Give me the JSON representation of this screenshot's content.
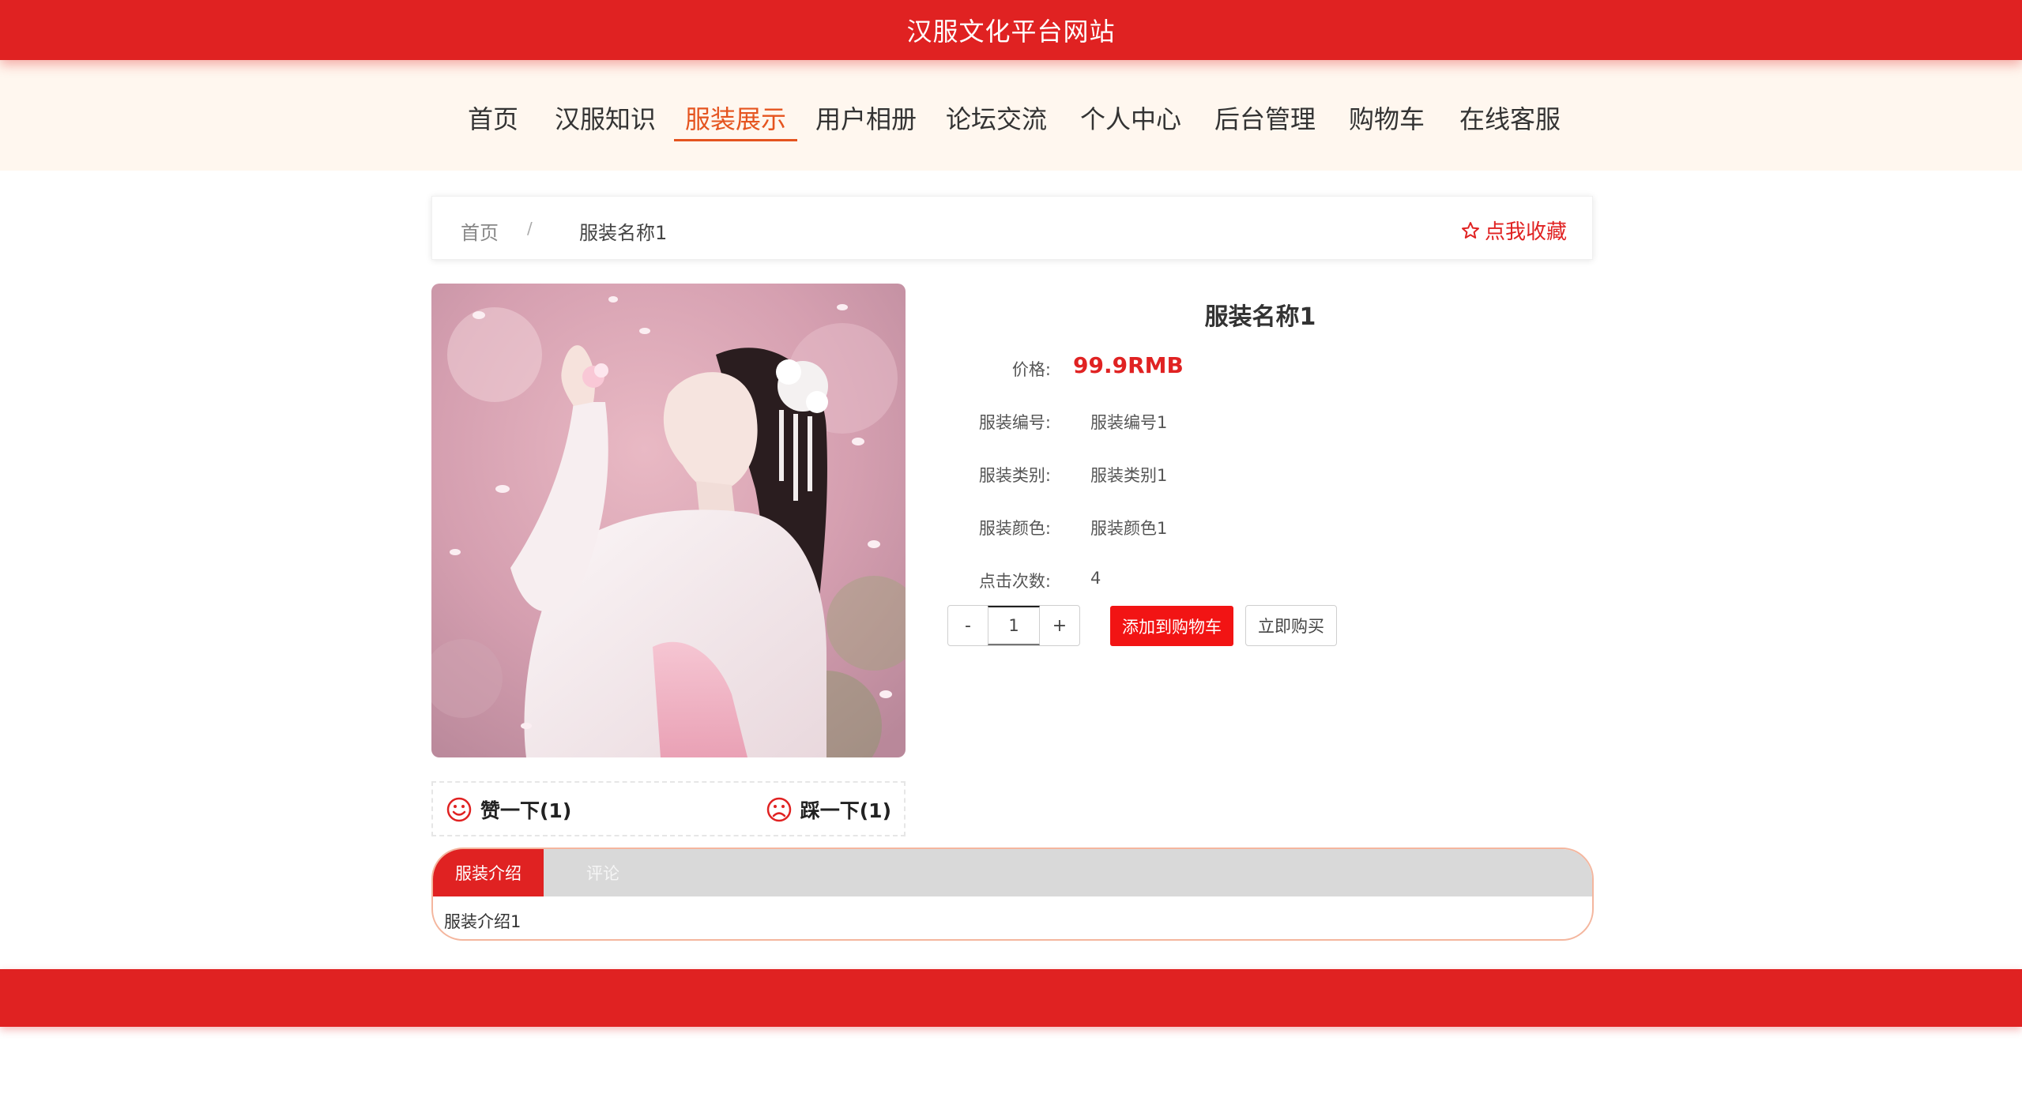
{
  "site_title": "汉服文化平台网站",
  "nav": {
    "items": [
      {
        "label": "首页"
      },
      {
        "label": "汉服知识"
      },
      {
        "label": "服装展示",
        "active": true
      },
      {
        "label": "用户相册"
      },
      {
        "label": "论坛交流"
      },
      {
        "label": "个人中心"
      },
      {
        "label": "后台管理"
      },
      {
        "label": "购物车"
      },
      {
        "label": "在线客服"
      }
    ]
  },
  "breadcrumb": {
    "home": "首页",
    "separator": "/",
    "current": "服装名称1",
    "favorite_label": "点我收藏",
    "favorite_icon": "star-outline-icon"
  },
  "product": {
    "name": "服装名称1",
    "price_label": "价格:",
    "price": "99.9RMB",
    "fields": [
      {
        "label": "服装编号:",
        "value": "服装编号1"
      },
      {
        "label": "服装类别:",
        "value": "服装类别1"
      },
      {
        "label": "服装颜色:",
        "value": "服装颜色1"
      },
      {
        "label": "点击次数:",
        "value": "4"
      }
    ],
    "image_desc": "hanfu-photo"
  },
  "quantity": {
    "minus": "-",
    "value": "1",
    "plus": "+"
  },
  "actions": {
    "add_to_cart": "添加到购物车",
    "buy_now": "立即购买"
  },
  "votes": {
    "up_label": "赞一下(1)",
    "up_icon": "smile-icon",
    "down_label": "踩一下(1)",
    "down_icon": "frown-icon"
  },
  "tabs": {
    "items": [
      {
        "label": "服装介绍",
        "active": true
      },
      {
        "label": "评论"
      }
    ],
    "content": "服装介绍1"
  },
  "colors": {
    "brand_red": "#e02222",
    "nav_active": "#e5541f",
    "nav_bg": "#fff7ef",
    "cart_button": "#f21414"
  }
}
